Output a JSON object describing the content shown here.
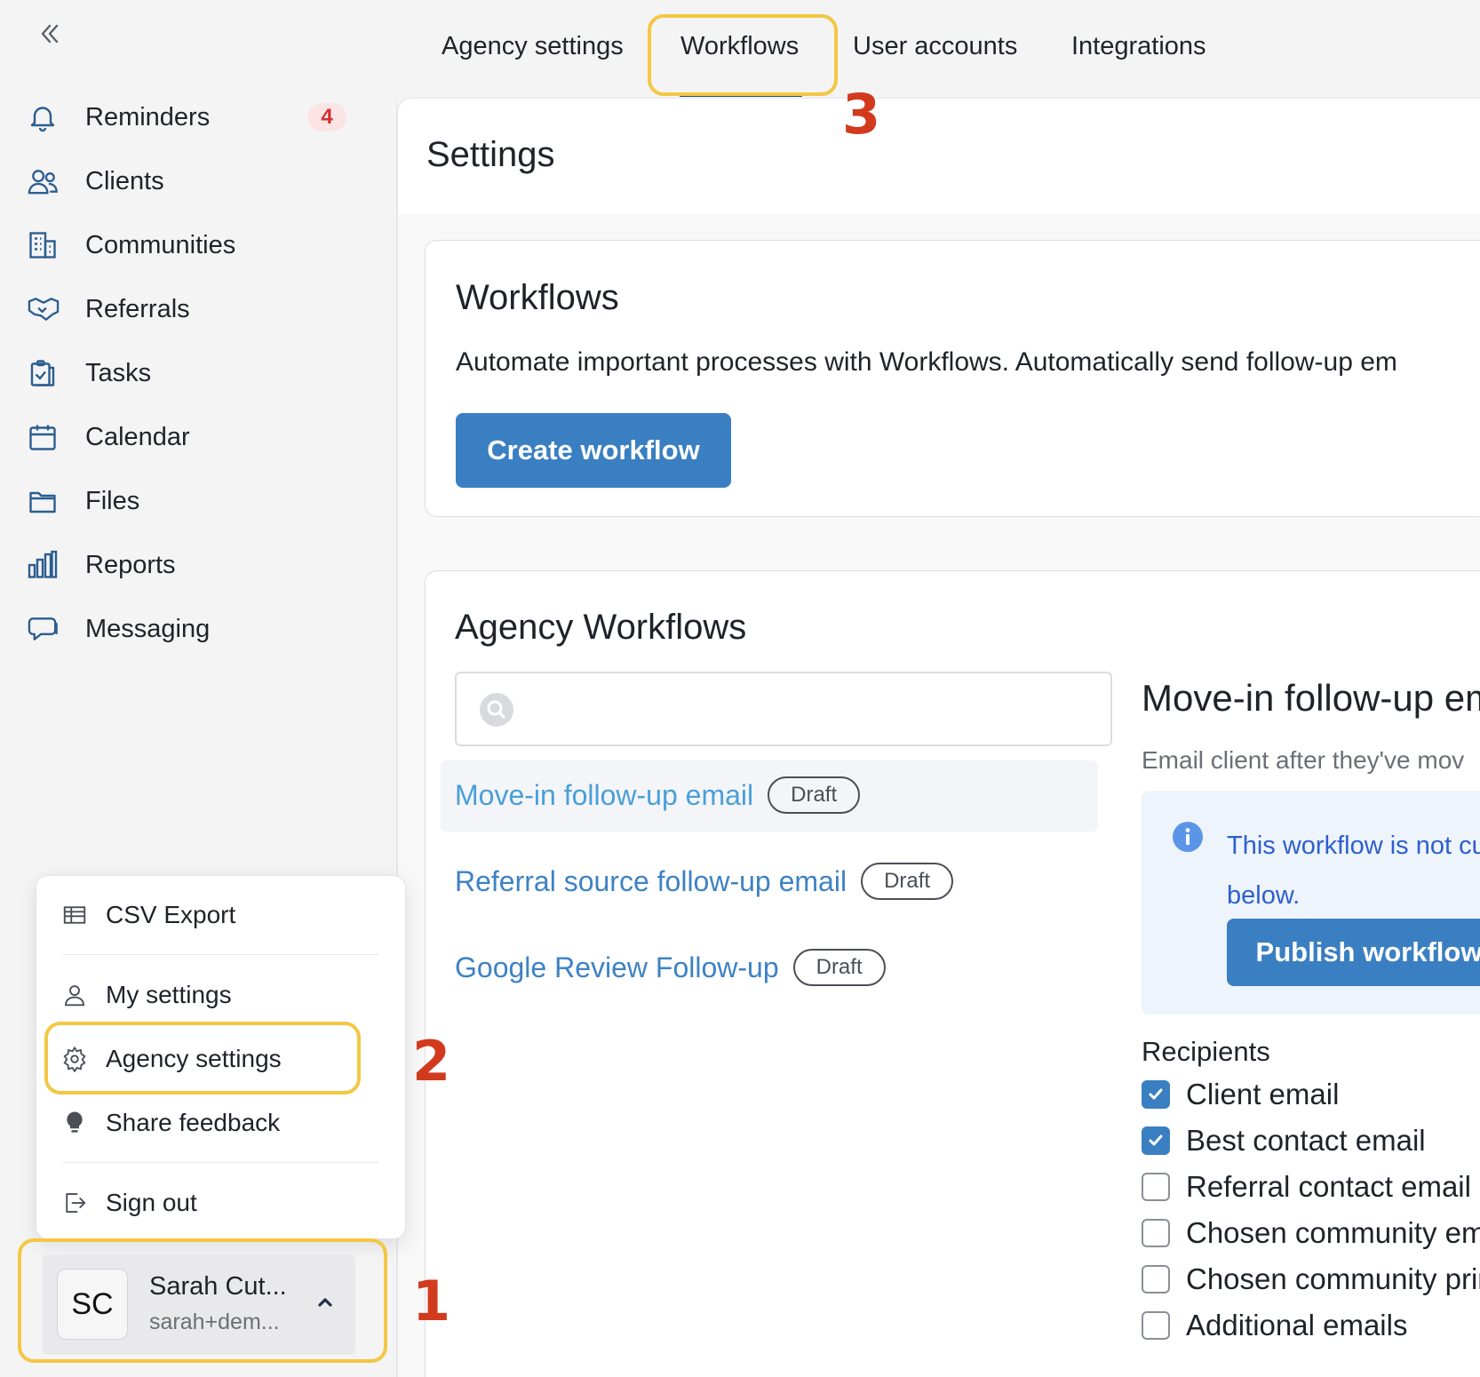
{
  "tabs": [
    {
      "label": "Agency settings"
    },
    {
      "label": "Workflows"
    },
    {
      "label": "User accounts"
    },
    {
      "label": "Integrations"
    }
  ],
  "sidebar": {
    "items": [
      {
        "label": "Reminders",
        "icon": "bell-icon",
        "badge": "4"
      },
      {
        "label": "Clients",
        "icon": "users-icon"
      },
      {
        "label": "Communities",
        "icon": "building-icon"
      },
      {
        "label": "Referrals",
        "icon": "handshake-icon"
      },
      {
        "label": "Tasks",
        "icon": "clipboard-check-icon"
      },
      {
        "label": "Calendar",
        "icon": "calendar-icon"
      },
      {
        "label": "Files",
        "icon": "folder-icon"
      },
      {
        "label": "Reports",
        "icon": "bar-chart-icon"
      },
      {
        "label": "Messaging",
        "icon": "chat-icon"
      }
    ]
  },
  "user_menu": {
    "items": [
      {
        "label": "CSV Export",
        "icon": "table-icon"
      },
      {
        "label": "My settings",
        "icon": "user-icon"
      },
      {
        "label": "Agency settings",
        "icon": "gear-icon"
      },
      {
        "label": "Share feedback",
        "icon": "lightbulb-icon"
      },
      {
        "label": "Sign out",
        "icon": "sign-out-icon"
      }
    ]
  },
  "user": {
    "initials": "SC",
    "name": "Sarah Cut...",
    "email": "sarah+dem..."
  },
  "annotations": {
    "step1": "1",
    "step2": "2",
    "step3": "3"
  },
  "page": {
    "title": "Settings"
  },
  "workflows_card": {
    "title": "Workflows",
    "description": "Automate important processes with Workflows. Automatically send follow-up em",
    "create_button": "Create workflow"
  },
  "agency_workflows": {
    "title": "Agency Workflows",
    "search_placeholder": "",
    "items": [
      {
        "name": "Move-in follow-up email",
        "status": "Draft"
      },
      {
        "name": "Referral source follow-up email",
        "status": "Draft"
      },
      {
        "name": "Google Review Follow-up",
        "status": "Draft"
      }
    ]
  },
  "detail": {
    "title": "Move-in follow-up em",
    "description": "Email client after they've mov",
    "notice": "This workflow is not cu\nbelow.",
    "publish_button": "Publish workflow",
    "recipients_title": "Recipients",
    "recipients": [
      {
        "label": "Client email",
        "checked": true
      },
      {
        "label": "Best contact email",
        "checked": true
      },
      {
        "label": "Referral contact email",
        "checked": false
      },
      {
        "label": "Chosen community em",
        "checked": false
      },
      {
        "label": "Chosen community prin",
        "checked": false
      },
      {
        "label": "Additional emails",
        "checked": false
      }
    ]
  },
  "colors": {
    "accent": "#3a7fc1",
    "link": "#3d82c4",
    "highlight": "#f3c744",
    "step_number": "#d23a1e",
    "badge_bg": "#fde4e4",
    "badge_text": "#d32f2f"
  }
}
